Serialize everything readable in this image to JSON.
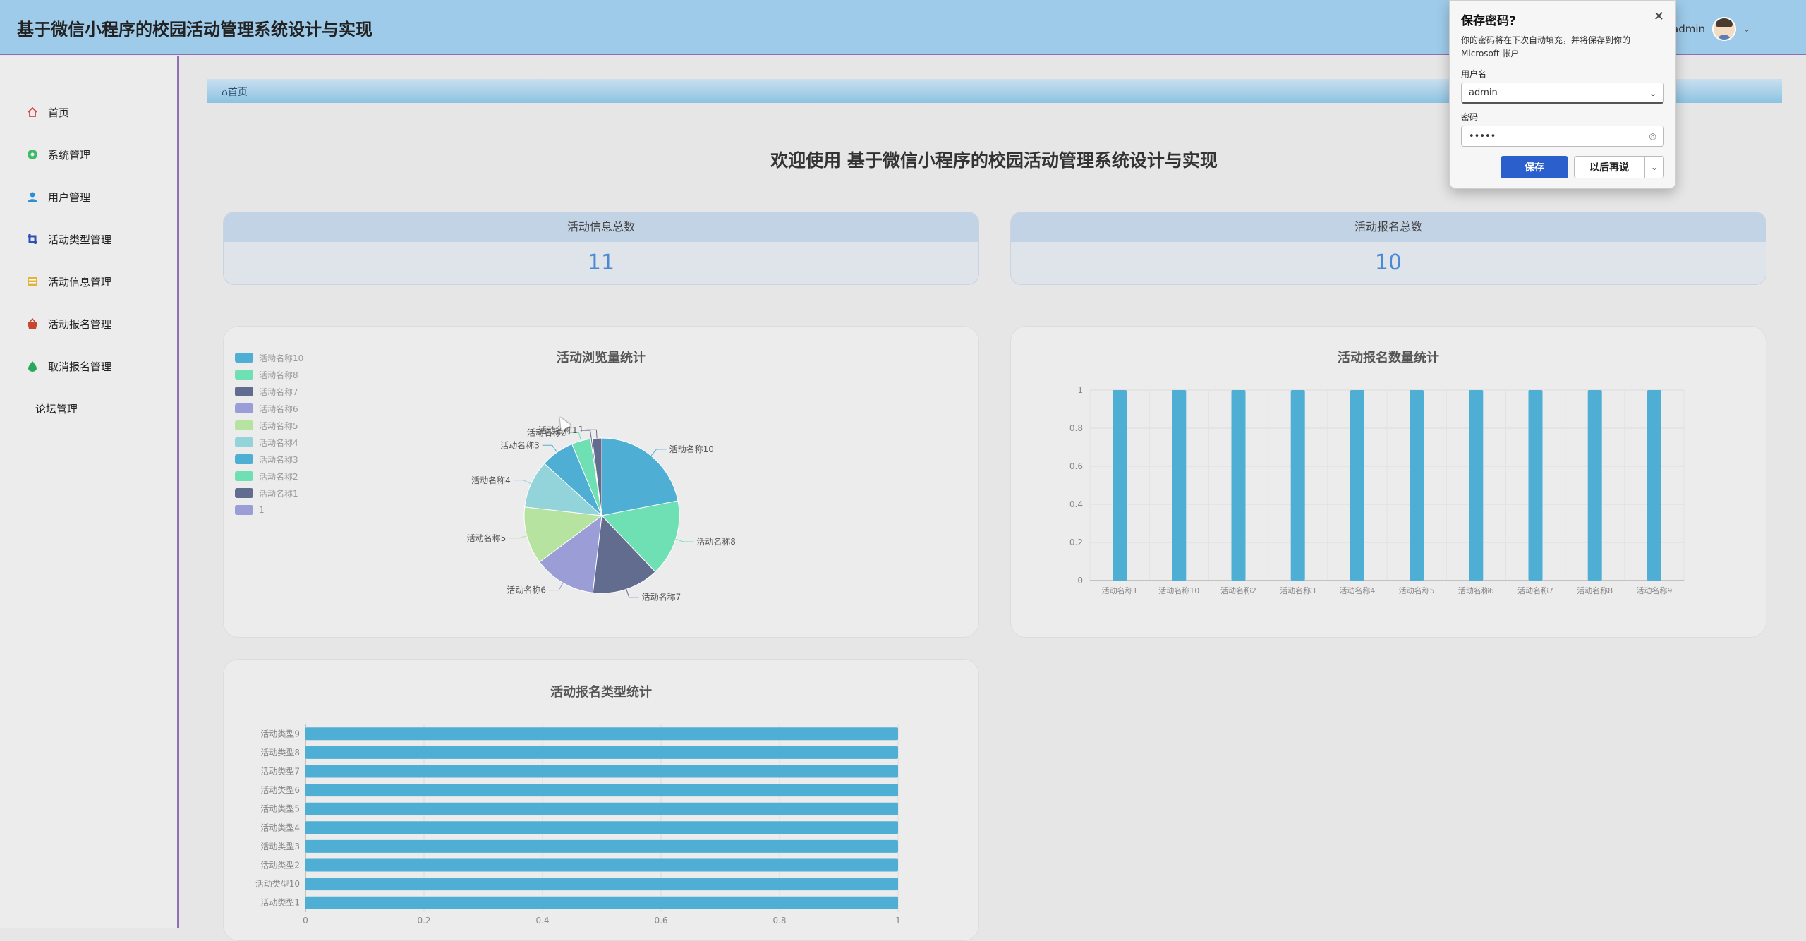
{
  "header": {
    "title": "基于微信小程序的校园活动管理系统设计与实现",
    "username": "admin"
  },
  "sidebar": {
    "items": [
      {
        "label": "首页",
        "icon": "home-icon"
      },
      {
        "label": "系统管理",
        "icon": "gear-icon"
      },
      {
        "label": "用户管理",
        "icon": "user-icon"
      },
      {
        "label": "活动类型管理",
        "icon": "crop-icon"
      },
      {
        "label": "活动信息管理",
        "icon": "list-icon"
      },
      {
        "label": "活动报名管理",
        "icon": "basket-icon"
      },
      {
        "label": "取消报名管理",
        "icon": "drop-icon"
      },
      {
        "label": "论坛管理",
        "icon": ""
      }
    ]
  },
  "breadcrumb": {
    "label": "首页"
  },
  "welcome": "欢迎使用 基于微信小程序的校园活动管理系统设计与实现",
  "stats": [
    {
      "label": "活动信息总数",
      "value": "11"
    },
    {
      "label": "活动报名总数",
      "value": "10"
    }
  ],
  "colors": {
    "accent": "#4a8ad4",
    "bar": "#4eaed3",
    "header": "#9ecbea",
    "sidebar_border": "#8e6fb3"
  },
  "chart_data": [
    {
      "type": "pie",
      "title": "活动浏览量统计",
      "legend_position": "top-left",
      "legend": [
        "活动名称10",
        "活动名称8",
        "活动名称7",
        "活动名称6",
        "活动名称5",
        "活动名称4",
        "活动名称3",
        "活动名称2",
        "活动名称1",
        "1"
      ],
      "slices": [
        {
          "name": "活动名称10",
          "value": 22,
          "color": "#4eaed3"
        },
        {
          "name": "活动名称8",
          "value": 16,
          "color": "#6fe0b3"
        },
        {
          "name": "活动名称7",
          "value": 14,
          "color": "#626c8e"
        },
        {
          "name": "活动名称6",
          "value": 13,
          "color": "#9b9ed6"
        },
        {
          "name": "活动名称5",
          "value": 12,
          "color": "#b6e3a0"
        },
        {
          "name": "活动名称4",
          "value": 10,
          "color": "#93d3da"
        },
        {
          "name": "活动名称3",
          "value": 7,
          "color": "#4eaed3"
        },
        {
          "name": "活动名称2",
          "value": 4,
          "color": "#6fe0b3"
        },
        {
          "name": "活动名称1",
          "value": 0.3,
          "color": "#626c8e"
        },
        {
          "name": "1",
          "value": 2,
          "color": "#626c8e"
        }
      ]
    },
    {
      "type": "bar",
      "title": "活动报名数量统计",
      "categories": [
        "活动名称1",
        "活动名称10",
        "活动名称2",
        "活动名称3",
        "活动名称4",
        "活动名称5",
        "活动名称6",
        "活动名称7",
        "活动名称8",
        "活动名称9"
      ],
      "values": [
        1,
        1,
        1,
        1,
        1,
        1,
        1,
        1,
        1,
        1
      ],
      "yticks": [
        "0",
        "0.2",
        "0.4",
        "0.6",
        "0.8",
        "1"
      ],
      "ylim": [
        0,
        1
      ],
      "grid": true
    },
    {
      "type": "bar",
      "orientation": "horizontal",
      "title": "活动报名类型统计",
      "categories": [
        "活动类型9",
        "活动类型8",
        "活动类型7",
        "活动类型6",
        "活动类型5",
        "活动类型4",
        "活动类型3",
        "活动类型2",
        "活动类型10",
        "活动类型1"
      ],
      "values": [
        1,
        1,
        1,
        1,
        1,
        1,
        1,
        1,
        1,
        1
      ],
      "xticks": [
        "0",
        "0.2",
        "0.4",
        "0.6",
        "0.8",
        "1"
      ],
      "xlim": [
        0,
        1
      ],
      "grid": true
    }
  ],
  "dialog": {
    "title": "保存密码?",
    "description": "你的密码将在下次自动填充，并将保存到你的 Microsoft 帐户",
    "username_label": "用户名",
    "username_value": "admin",
    "password_label": "密码",
    "password_value": "•••••",
    "save_label": "保存",
    "later_label": "以后再说"
  }
}
